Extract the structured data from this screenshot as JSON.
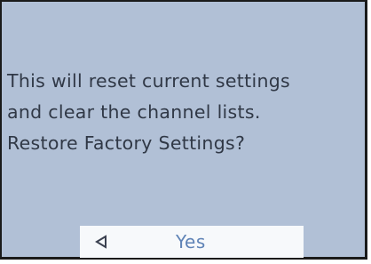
{
  "dialog": {
    "message_lines": [
      "This will reset current settings",
      "and clear the channel lists.",
      "Restore Factory Settings?"
    ],
    "option": {
      "label": "Yes",
      "icon": "left-arrow-icon"
    }
  },
  "colors": {
    "background": "#b1c0d6",
    "text": "#303846",
    "option_background": "#f7f9fb",
    "option_text": "#5f83b6"
  }
}
